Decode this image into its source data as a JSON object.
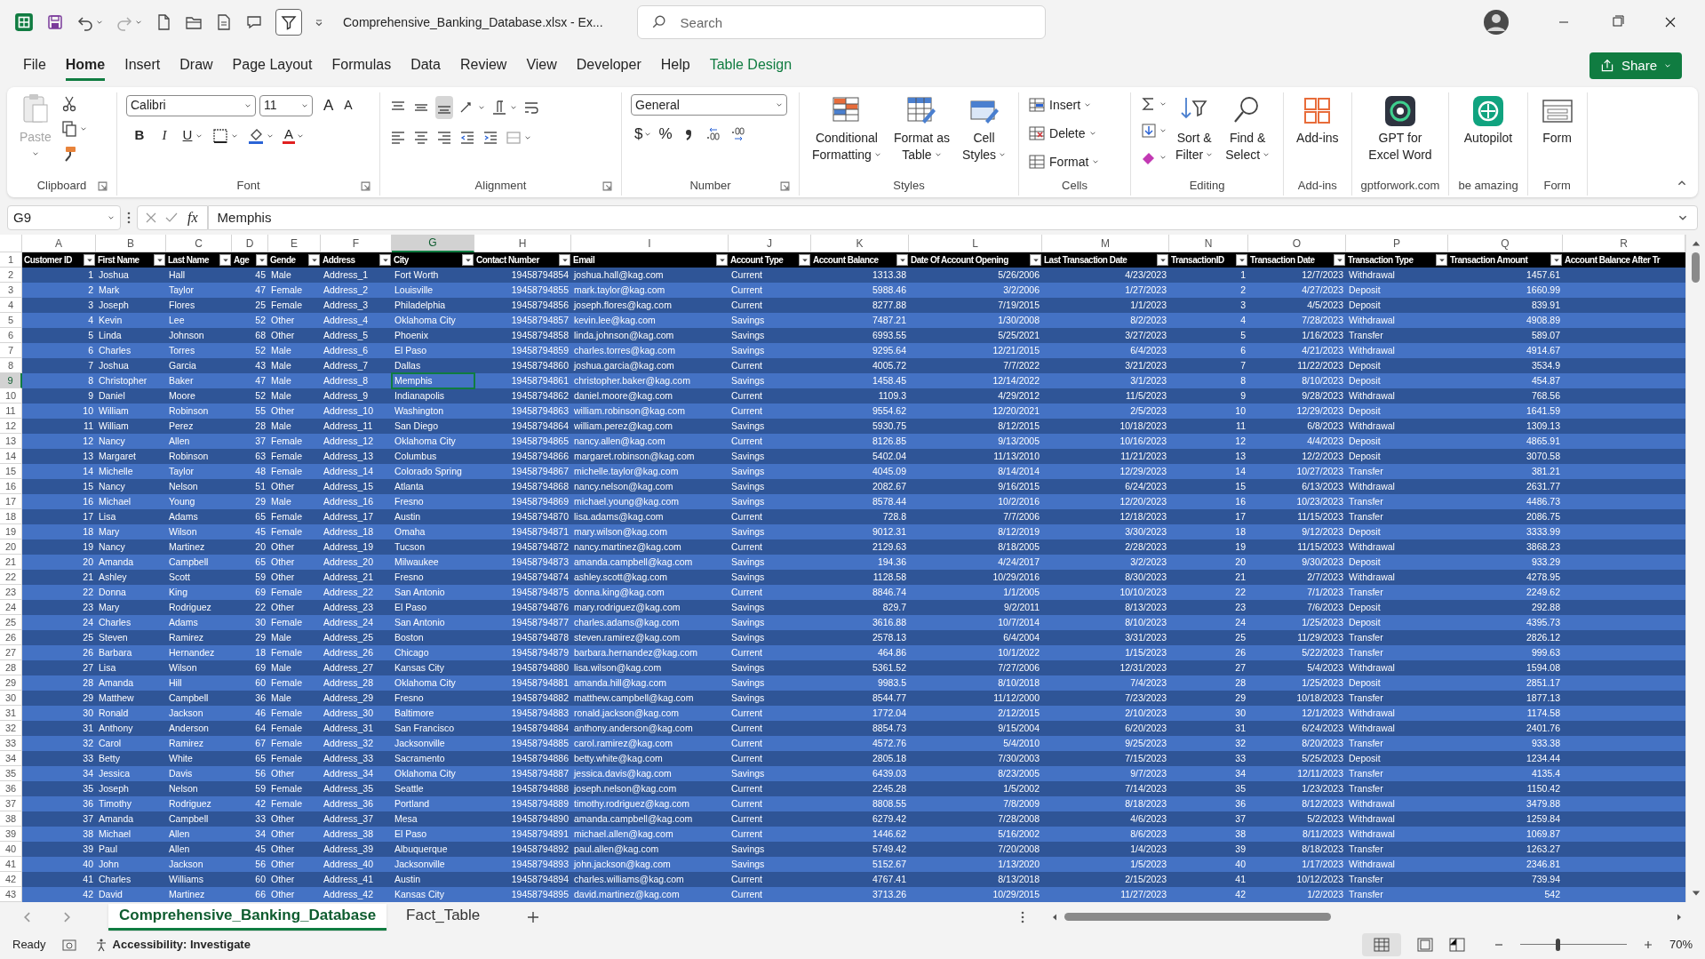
{
  "title_bar": {
    "title": "Comprehensive_Banking_Database.xlsx  -  Ex...",
    "search": {
      "placeholder": "Search"
    }
  },
  "menu_tabs": [
    {
      "label": "File",
      "selected": false,
      "kind": "standard"
    },
    {
      "label": "Home",
      "selected": true,
      "kind": "standard"
    },
    {
      "label": "Insert",
      "selected": false,
      "kind": "standard"
    },
    {
      "label": "Draw",
      "selected": false,
      "kind": "standard"
    },
    {
      "label": "Page Layout",
      "selected": false,
      "kind": "standard"
    },
    {
      "label": "Formulas",
      "selected": false,
      "kind": "standard"
    },
    {
      "label": "Data",
      "selected": false,
      "kind": "standard"
    },
    {
      "label": "Review",
      "selected": false,
      "kind": "standard"
    },
    {
      "label": "View",
      "selected": false,
      "kind": "standard"
    },
    {
      "label": "Developer",
      "selected": false,
      "kind": "standard"
    },
    {
      "label": "Help",
      "selected": false,
      "kind": "standard"
    },
    {
      "label": "Table Design",
      "selected": false,
      "kind": "contextual"
    }
  ],
  "share_button": "Share",
  "ribbon": {
    "groups": [
      {
        "kind": "clipboard",
        "label": "Clipboard",
        "paste": {
          "label": "Paste",
          "disabled": true
        }
      },
      {
        "kind": "font",
        "label": "Font",
        "font_name": "Calibri",
        "font_size": "11",
        "grow_font": "A",
        "shrink_font": "A",
        "bold": "B",
        "italic": "I",
        "underline": "U",
        "font_color": "A"
      },
      {
        "kind": "alignment",
        "label": "Alignment"
      },
      {
        "kind": "number",
        "label": "Number",
        "format": "General",
        "currency": "$",
        "percent": "%"
      },
      {
        "kind": "large",
        "label": "Styles",
        "buttons": [
          {
            "lines": [
              "Conditional",
              "Formatting"
            ],
            "dropdown": true
          },
          {
            "lines": [
              "Format as",
              "Table"
            ],
            "dropdown": true
          },
          {
            "lines": [
              "Cell",
              "Styles"
            ],
            "dropdown": true
          }
        ]
      },
      {
        "kind": "cells",
        "label": "Cells",
        "buttons": [
          {
            "label": "Insert"
          },
          {
            "label": "Delete"
          },
          {
            "label": "Format"
          }
        ]
      },
      {
        "kind": "editing",
        "label": "Editing",
        "buttons": [
          {
            "lines": [
              "Sort &",
              "Filter"
            ],
            "dropdown": true
          },
          {
            "lines": [
              "Find &",
              "Select"
            ],
            "dropdown": true
          }
        ]
      },
      {
        "kind": "large",
        "label": "Add-ins",
        "buttons": [
          {
            "lines": [
              "Add-ins"
            ],
            "dropdown": false
          }
        ]
      },
      {
        "kind": "large",
        "label": "gptforwork.com",
        "buttons": [
          {
            "lines": [
              "GPT for",
              "Excel Word"
            ],
            "dropdown": false
          }
        ]
      },
      {
        "kind": "large",
        "label": "be amazing",
        "buttons": [
          {
            "lines": [
              "Autopilot"
            ],
            "dropdown": false
          }
        ]
      },
      {
        "kind": "large",
        "label": "Form",
        "buttons": [
          {
            "lines": [
              "Form"
            ],
            "dropdown": false
          }
        ]
      }
    ]
  },
  "formula_bar": {
    "name_box": "G9",
    "function_label": "fx",
    "value": "Memphis"
  },
  "sheet": {
    "header_row": {
      "number": "1",
      "selected": false
    },
    "columns": [
      {
        "letter": "A",
        "header": "Customer ID",
        "kind": "number",
        "filter": true,
        "selected": false
      },
      {
        "letter": "B",
        "header": "First Name",
        "kind": "text",
        "filter": true,
        "selected": false
      },
      {
        "letter": "C",
        "header": "Last Name",
        "kind": "text",
        "filter": true,
        "selected": false
      },
      {
        "letter": "D",
        "header": "Age",
        "kind": "number",
        "filter": true,
        "selected": false
      },
      {
        "letter": "E",
        "header": "Gende",
        "kind": "text",
        "filter": true,
        "selected": false
      },
      {
        "letter": "F",
        "header": "Address",
        "kind": "text",
        "filter": true,
        "selected": false
      },
      {
        "letter": "G",
        "header": "City",
        "kind": "text",
        "filter": true,
        "selected": true
      },
      {
        "letter": "H",
        "header": "Contact Number",
        "kind": "number",
        "filter": true,
        "selected": false
      },
      {
        "letter": "I",
        "header": "Email",
        "kind": "text",
        "filter": true,
        "selected": false
      },
      {
        "letter": "J",
        "header": "Account Type",
        "kind": "text",
        "filter": true,
        "selected": false
      },
      {
        "letter": "K",
        "header": "Account Balance",
        "kind": "number",
        "filter": true,
        "selected": false
      },
      {
        "letter": "L",
        "header": "Date Of Account Opening",
        "kind": "number",
        "filter": true,
        "selected": false
      },
      {
        "letter": "M",
        "header": "Last Transaction Date",
        "kind": "number",
        "filter": true,
        "selected": false
      },
      {
        "letter": "N",
        "header": "TransactionID",
        "kind": "number",
        "filter": true,
        "selected": false
      },
      {
        "letter": "O",
        "header": "Transaction Date",
        "kind": "number",
        "filter": true,
        "selected": false
      },
      {
        "letter": "P",
        "header": "Transaction Type",
        "kind": "text",
        "filter": true,
        "selected": false
      },
      {
        "letter": "Q",
        "header": "Transaction Amount",
        "kind": "number",
        "filter": true,
        "selected": false
      },
      {
        "letter": "R",
        "header": "Account Balance After Tr",
        "kind": "text",
        "filter": false,
        "selected": false
      }
    ],
    "rows": [
      {
        "number": "2",
        "selected": false,
        "cells": [
          "1",
          "Joshua",
          "Hall",
          "45",
          "Male",
          "Address_1",
          "Fort Worth",
          "19458794854",
          "joshua.hall@kag.com",
          "Current",
          "1313.38",
          "5/26/2006",
          "4/23/2023",
          "1",
          "12/7/2023",
          "Withdrawal",
          "1457.61"
        ]
      },
      {
        "number": "3",
        "selected": false,
        "cells": [
          "2",
          "Mark",
          "Taylor",
          "47",
          "Female",
          "Address_2",
          "Louisville",
          "19458794855",
          "mark.taylor@kag.com",
          "Current",
          "5988.46",
          "3/2/2006",
          "1/27/2023",
          "2",
          "4/27/2023",
          "Deposit",
          "1660.99"
        ]
      },
      {
        "number": "4",
        "selected": false,
        "cells": [
          "3",
          "Joseph",
          "Flores",
          "25",
          "Female",
          "Address_3",
          "Philadelphia",
          "19458794856",
          "joseph.flores@kag.com",
          "Current",
          "8277.88",
          "7/19/2015",
          "1/1/2023",
          "3",
          "4/5/2023",
          "Deposit",
          "839.91"
        ]
      },
      {
        "number": "5",
        "selected": false,
        "cells": [
          "4",
          "Kevin",
          "Lee",
          "52",
          "Other",
          "Address_4",
          "Oklahoma City",
          "19458794857",
          "kevin.lee@kag.com",
          "Savings",
          "7487.21",
          "1/30/2008",
          "8/2/2023",
          "4",
          "7/28/2023",
          "Withdrawal",
          "4908.89"
        ]
      },
      {
        "number": "6",
        "selected": false,
        "cells": [
          "5",
          "Linda",
          "Johnson",
          "68",
          "Other",
          "Address_5",
          "Phoenix",
          "19458794858",
          "linda.johnson@kag.com",
          "Savings",
          "6993.55",
          "5/25/2021",
          "3/27/2023",
          "5",
          "1/16/2023",
          "Transfer",
          "589.07"
        ]
      },
      {
        "number": "7",
        "selected": false,
        "cells": [
          "6",
          "Charles",
          "Torres",
          "52",
          "Male",
          "Address_6",
          "El Paso",
          "19458794859",
          "charles.torres@kag.com",
          "Savings",
          "9295.64",
          "12/21/2015",
          "6/4/2023",
          "6",
          "4/21/2023",
          "Withdrawal",
          "4914.67"
        ]
      },
      {
        "number": "8",
        "selected": false,
        "cells": [
          "7",
          "Joshua",
          "Garcia",
          "43",
          "Male",
          "Address_7",
          "Dallas",
          "19458794860",
          "joshua.garcia@kag.com",
          "Current",
          "4005.72",
          "7/7/2022",
          "3/21/2023",
          "7",
          "11/22/2023",
          "Deposit",
          "3534.9"
        ]
      },
      {
        "number": "9",
        "selected": true,
        "cells": [
          "8",
          "Christopher",
          "Baker",
          "47",
          "Male",
          "Address_8",
          "Memphis",
          "19458794861",
          "christopher.baker@kag.com",
          "Savings",
          "1458.45",
          "12/14/2022",
          "3/1/2023",
          "8",
          "8/10/2023",
          "Deposit",
          "454.87"
        ]
      },
      {
        "number": "10",
        "selected": false,
        "cells": [
          "9",
          "Daniel",
          "Moore",
          "52",
          "Male",
          "Address_9",
          "Indianapolis",
          "19458794862",
          "daniel.moore@kag.com",
          "Current",
          "1109.3",
          "4/29/2012",
          "11/5/2023",
          "9",
          "9/28/2023",
          "Withdrawal",
          "768.56"
        ]
      },
      {
        "number": "11",
        "selected": false,
        "cells": [
          "10",
          "William",
          "Robinson",
          "55",
          "Other",
          "Address_10",
          "Washington",
          "19458794863",
          "william.robinson@kag.com",
          "Current",
          "9554.62",
          "12/20/2021",
          "2/5/2023",
          "10",
          "12/29/2023",
          "Deposit",
          "1641.59"
        ]
      },
      {
        "number": "12",
        "selected": false,
        "cells": [
          "11",
          "William",
          "Perez",
          "28",
          "Male",
          "Address_11",
          "San Diego",
          "19458794864",
          "william.perez@kag.com",
          "Savings",
          "5930.75",
          "8/12/2015",
          "10/18/2023",
          "11",
          "6/8/2023",
          "Withdrawal",
          "1309.13"
        ]
      },
      {
        "number": "13",
        "selected": false,
        "cells": [
          "12",
          "Nancy",
          "Allen",
          "37",
          "Female",
          "Address_12",
          "Oklahoma City",
          "19458794865",
          "nancy.allen@kag.com",
          "Current",
          "8126.85",
          "9/13/2005",
          "10/16/2023",
          "12",
          "4/4/2023",
          "Deposit",
          "4865.91"
        ]
      },
      {
        "number": "14",
        "selected": false,
        "cells": [
          "13",
          "Margaret",
          "Robinson",
          "63",
          "Female",
          "Address_13",
          "Columbus",
          "19458794866",
          "margaret.robinson@kag.com",
          "Savings",
          "5402.04",
          "11/13/2010",
          "11/21/2023",
          "13",
          "12/2/2023",
          "Deposit",
          "3070.58"
        ]
      },
      {
        "number": "15",
        "selected": false,
        "cells": [
          "14",
          "Michelle",
          "Taylor",
          "48",
          "Female",
          "Address_14",
          "Colorado Spring",
          "19458794867",
          "michelle.taylor@kag.com",
          "Savings",
          "4045.09",
          "8/14/2014",
          "12/29/2023",
          "14",
          "10/27/2023",
          "Transfer",
          "381.21"
        ]
      },
      {
        "number": "16",
        "selected": false,
        "cells": [
          "15",
          "Nancy",
          "Nelson",
          "51",
          "Other",
          "Address_15",
          "Atlanta",
          "19458794868",
          "nancy.nelson@kag.com",
          "Savings",
          "2082.67",
          "9/16/2015",
          "6/24/2023",
          "15",
          "6/13/2023",
          "Withdrawal",
          "2631.77"
        ]
      },
      {
        "number": "17",
        "selected": false,
        "cells": [
          "16",
          "Michael",
          "Young",
          "29",
          "Male",
          "Address_16",
          "Fresno",
          "19458794869",
          "michael.young@kag.com",
          "Savings",
          "8578.44",
          "10/2/2016",
          "12/20/2023",
          "16",
          "10/23/2023",
          "Transfer",
          "4486.73"
        ]
      },
      {
        "number": "18",
        "selected": false,
        "cells": [
          "17",
          "Lisa",
          "Adams",
          "65",
          "Female",
          "Address_17",
          "Austin",
          "19458794870",
          "lisa.adams@kag.com",
          "Current",
          "728.8",
          "7/7/2006",
          "12/18/2023",
          "17",
          "11/15/2023",
          "Transfer",
          "2086.75"
        ]
      },
      {
        "number": "19",
        "selected": false,
        "cells": [
          "18",
          "Mary",
          "Wilson",
          "45",
          "Female",
          "Address_18",
          "Omaha",
          "19458794871",
          "mary.wilson@kag.com",
          "Savings",
          "9012.31",
          "8/12/2019",
          "3/30/2023",
          "18",
          "9/12/2023",
          "Deposit",
          "3333.99"
        ]
      },
      {
        "number": "20",
        "selected": false,
        "cells": [
          "19",
          "Nancy",
          "Martinez",
          "20",
          "Other",
          "Address_19",
          "Tucson",
          "19458794872",
          "nancy.martinez@kag.com",
          "Current",
          "2129.63",
          "8/18/2005",
          "2/28/2023",
          "19",
          "11/15/2023",
          "Withdrawal",
          "3868.23"
        ]
      },
      {
        "number": "21",
        "selected": false,
        "cells": [
          "20",
          "Amanda",
          "Campbell",
          "65",
          "Other",
          "Address_20",
          "Milwaukee",
          "19458794873",
          "amanda.campbell@kag.com",
          "Savings",
          "194.36",
          "4/24/2017",
          "3/2/2023",
          "20",
          "9/30/2023",
          "Deposit",
          "933.29"
        ]
      },
      {
        "number": "22",
        "selected": false,
        "cells": [
          "21",
          "Ashley",
          "Scott",
          "59",
          "Other",
          "Address_21",
          "Fresno",
          "19458794874",
          "ashley.scott@kag.com",
          "Savings",
          "1128.58",
          "10/29/2016",
          "8/30/2023",
          "21",
          "2/7/2023",
          "Withdrawal",
          "4278.95"
        ]
      },
      {
        "number": "23",
        "selected": false,
        "cells": [
          "22",
          "Donna",
          "King",
          "69",
          "Female",
          "Address_22",
          "San Antonio",
          "19458794875",
          "donna.king@kag.com",
          "Current",
          "8846.74",
          "1/1/2005",
          "10/10/2023",
          "22",
          "7/1/2023",
          "Transfer",
          "2249.62"
        ]
      },
      {
        "number": "24",
        "selected": false,
        "cells": [
          "23",
          "Mary",
          "Rodriguez",
          "22",
          "Other",
          "Address_23",
          "El Paso",
          "19458794876",
          "mary.rodriguez@kag.com",
          "Savings",
          "829.7",
          "9/2/2011",
          "8/13/2023",
          "23",
          "7/6/2023",
          "Deposit",
          "292.88"
        ]
      },
      {
        "number": "25",
        "selected": false,
        "cells": [
          "24",
          "Charles",
          "Adams",
          "30",
          "Female",
          "Address_24",
          "San Antonio",
          "19458794877",
          "charles.adams@kag.com",
          "Savings",
          "3616.88",
          "10/7/2014",
          "8/10/2023",
          "24",
          "1/25/2023",
          "Deposit",
          "4395.73"
        ]
      },
      {
        "number": "26",
        "selected": false,
        "cells": [
          "25",
          "Steven",
          "Ramirez",
          "29",
          "Male",
          "Address_25",
          "Boston",
          "19458794878",
          "steven.ramirez@kag.com",
          "Savings",
          "2578.13",
          "6/4/2004",
          "3/31/2023",
          "25",
          "11/29/2023",
          "Transfer",
          "2826.12"
        ]
      },
      {
        "number": "27",
        "selected": false,
        "cells": [
          "26",
          "Barbara",
          "Hernandez",
          "18",
          "Female",
          "Address_26",
          "Chicago",
          "19458794879",
          "barbara.hernandez@kag.com",
          "Current",
          "464.86",
          "10/1/2022",
          "1/15/2023",
          "26",
          "5/22/2023",
          "Transfer",
          "999.63"
        ]
      },
      {
        "number": "28",
        "selected": false,
        "cells": [
          "27",
          "Lisa",
          "Wilson",
          "69",
          "Male",
          "Address_27",
          "Kansas City",
          "19458794880",
          "lisa.wilson@kag.com",
          "Savings",
          "5361.52",
          "7/27/2006",
          "12/31/2023",
          "27",
          "5/4/2023",
          "Withdrawal",
          "1594.08"
        ]
      },
      {
        "number": "29",
        "selected": false,
        "cells": [
          "28",
          "Amanda",
          "Hill",
          "60",
          "Female",
          "Address_28",
          "Oklahoma City",
          "19458794881",
          "amanda.hill@kag.com",
          "Savings",
          "9983.5",
          "8/10/2018",
          "7/4/2023",
          "28",
          "1/25/2023",
          "Deposit",
          "2851.17"
        ]
      },
      {
        "number": "30",
        "selected": false,
        "cells": [
          "29",
          "Matthew",
          "Campbell",
          "36",
          "Male",
          "Address_29",
          "Fresno",
          "19458794882",
          "matthew.campbell@kag.com",
          "Savings",
          "8544.77",
          "11/12/2000",
          "7/23/2023",
          "29",
          "10/18/2023",
          "Transfer",
          "1877.13"
        ]
      },
      {
        "number": "31",
        "selected": false,
        "cells": [
          "30",
          "Ronald",
          "Jackson",
          "46",
          "Female",
          "Address_30",
          "Baltimore",
          "19458794883",
          "ronald.jackson@kag.com",
          "Current",
          "1772.04",
          "2/12/2015",
          "2/10/2023",
          "30",
          "12/1/2023",
          "Withdrawal",
          "1174.58"
        ]
      },
      {
        "number": "32",
        "selected": false,
        "cells": [
          "31",
          "Anthony",
          "Anderson",
          "64",
          "Female",
          "Address_31",
          "San Francisco",
          "19458794884",
          "anthony.anderson@kag.com",
          "Current",
          "8854.73",
          "9/15/2004",
          "6/20/2023",
          "31",
          "6/24/2023",
          "Withdrawal",
          "2401.76"
        ]
      },
      {
        "number": "33",
        "selected": false,
        "cells": [
          "32",
          "Carol",
          "Ramirez",
          "67",
          "Female",
          "Address_32",
          "Jacksonville",
          "19458794885",
          "carol.ramirez@kag.com",
          "Current",
          "4572.76",
          "5/4/2010",
          "9/25/2023",
          "32",
          "8/20/2023",
          "Transfer",
          "933.38"
        ]
      },
      {
        "number": "34",
        "selected": false,
        "cells": [
          "33",
          "Betty",
          "White",
          "65",
          "Female",
          "Address_33",
          "Sacramento",
          "19458794886",
          "betty.white@kag.com",
          "Current",
          "2805.18",
          "7/30/2003",
          "7/15/2023",
          "33",
          "5/25/2023",
          "Deposit",
          "1234.44"
        ]
      },
      {
        "number": "35",
        "selected": false,
        "cells": [
          "34",
          "Jessica",
          "Davis",
          "56",
          "Other",
          "Address_34",
          "Oklahoma City",
          "19458794887",
          "jessica.davis@kag.com",
          "Savings",
          "6439.03",
          "8/23/2005",
          "9/7/2023",
          "34",
          "12/11/2023",
          "Transfer",
          "4135.4"
        ]
      },
      {
        "number": "36",
        "selected": false,
        "cells": [
          "35",
          "Joseph",
          "Nelson",
          "59",
          "Female",
          "Address_35",
          "Seattle",
          "19458794888",
          "joseph.nelson@kag.com",
          "Current",
          "2245.28",
          "1/5/2002",
          "7/14/2023",
          "35",
          "1/23/2023",
          "Transfer",
          "1150.42"
        ]
      },
      {
        "number": "37",
        "selected": false,
        "cells": [
          "36",
          "Timothy",
          "Rodriguez",
          "42",
          "Female",
          "Address_36",
          "Portland",
          "19458794889",
          "timothy.rodriguez@kag.com",
          "Current",
          "8808.55",
          "7/8/2009",
          "8/18/2023",
          "36",
          "8/12/2023",
          "Withdrawal",
          "3479.88"
        ]
      },
      {
        "number": "38",
        "selected": false,
        "cells": [
          "37",
          "Amanda",
          "Campbell",
          "33",
          "Other",
          "Address_37",
          "Mesa",
          "19458794890",
          "amanda.campbell@kag.com",
          "Current",
          "6279.42",
          "7/28/2008",
          "4/6/2023",
          "37",
          "5/2/2023",
          "Withdrawal",
          "1259.84"
        ]
      },
      {
        "number": "39",
        "selected": false,
        "cells": [
          "38",
          "Michael",
          "Allen",
          "34",
          "Other",
          "Address_38",
          "El Paso",
          "19458794891",
          "michael.allen@kag.com",
          "Current",
          "1446.62",
          "5/16/2002",
          "8/6/2023",
          "38",
          "8/11/2023",
          "Withdrawal",
          "1069.87"
        ]
      },
      {
        "number": "40",
        "selected": false,
        "cells": [
          "39",
          "Paul",
          "Allen",
          "45",
          "Other",
          "Address_39",
          "Albuquerque",
          "19458794892",
          "paul.allen@kag.com",
          "Savings",
          "5749.42",
          "7/20/2008",
          "1/4/2023",
          "39",
          "8/18/2023",
          "Transfer",
          "1263.27"
        ]
      },
      {
        "number": "41",
        "selected": false,
        "cells": [
          "40",
          "John",
          "Jackson",
          "56",
          "Other",
          "Address_40",
          "Jacksonville",
          "19458794893",
          "john.jackson@kag.com",
          "Savings",
          "5152.67",
          "1/13/2020",
          "1/5/2023",
          "40",
          "1/17/2023",
          "Withdrawal",
          "2346.81"
        ]
      },
      {
        "number": "42",
        "selected": false,
        "cells": [
          "41",
          "Charles",
          "Williams",
          "60",
          "Other",
          "Address_41",
          "Austin",
          "19458794894",
          "charles.williams@kag.com",
          "Current",
          "4767.41",
          "8/13/2018",
          "2/15/2023",
          "41",
          "10/12/2023",
          "Transfer",
          "739.94"
        ]
      },
      {
        "number": "43",
        "selected": false,
        "cells": [
          "42",
          "David",
          "Martinez",
          "66",
          "Other",
          "Address_42",
          "Kansas City",
          "19458794895",
          "david.martinez@kag.com",
          "Current",
          "3713.26",
          "10/29/2015",
          "11/27/2023",
          "42",
          "1/2/2023",
          "Transfer",
          "542"
        ]
      }
    ]
  },
  "sheet_tabs": [
    {
      "label": "Comprehensive_Banking_Database",
      "selected": true
    },
    {
      "label": "Fact_Table",
      "selected": false
    }
  ],
  "status_bar": {
    "status": "Ready",
    "accessibility": "Accessibility: Investigate",
    "zoom": {
      "level": 0.35,
      "reading": "70%"
    }
  }
}
